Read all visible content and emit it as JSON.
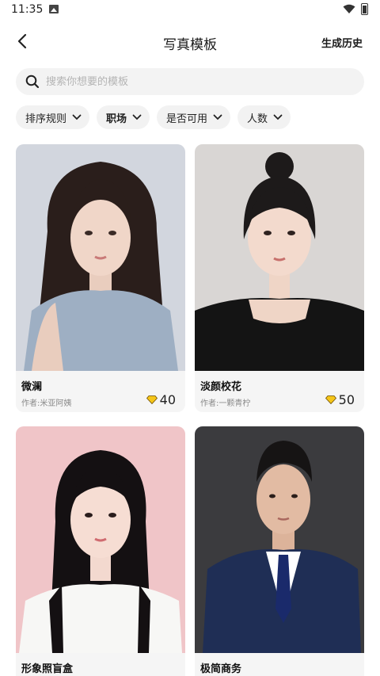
{
  "status": {
    "time": "11:35"
  },
  "header": {
    "title": "写真模板",
    "history": "生成历史"
  },
  "search": {
    "placeholder": "搜索你想要的模板"
  },
  "filters": [
    {
      "label": "排序规则",
      "active": false
    },
    {
      "label": "职场",
      "active": true
    },
    {
      "label": "是否可用",
      "active": false
    },
    {
      "label": "人数",
      "active": false
    }
  ],
  "cards": [
    {
      "title": "微澜",
      "author": "作者:米亚阿姨",
      "price": "40"
    },
    {
      "title": "淡颜校花",
      "author": "作者:一颗青柠",
      "price": "50"
    },
    {
      "title": "形象照盲盒",
      "author": "",
      "price": ""
    },
    {
      "title": "极简商务",
      "author": "",
      "price": ""
    }
  ],
  "colors": {
    "accent_gold": "#f5c518",
    "chip_bg": "#f2f2f2",
    "search_bg": "#f3f3f3"
  }
}
